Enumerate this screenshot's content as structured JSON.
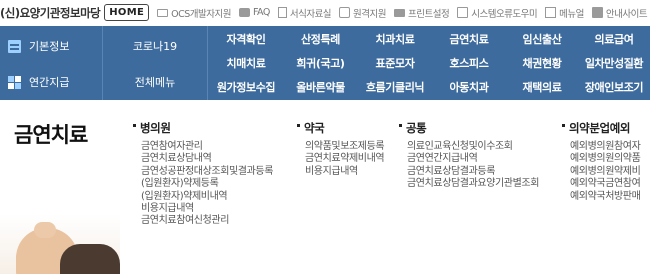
{
  "topbar": {
    "brand": "(신)요양기관정보마당",
    "home_label": "HOME",
    "links": [
      {
        "icon": "monitor-icon",
        "label": "OCS개발자지원"
      },
      {
        "icon": "chat-icon",
        "label": "FAQ"
      },
      {
        "icon": "document-icon",
        "label": "서식자료실"
      },
      {
        "icon": "remote-support-icon",
        "label": "원격지원"
      },
      {
        "icon": "printer-icon",
        "label": "프린트설정"
      },
      {
        "icon": "system-error-icon",
        "label": "시스템오류도우미"
      },
      {
        "icon": "menu-icon",
        "label": "메뉴얼"
      },
      {
        "icon": "site-guide-icon",
        "label": "안내사이트"
      }
    ]
  },
  "nav": {
    "left": [
      {
        "icon": "basic-info-icon",
        "label": "기본정보"
      },
      {
        "icon": "year-payment-icon",
        "label": "연간지급"
      }
    ],
    "middle": [
      {
        "label": "코로나19"
      },
      {
        "label": "전체메뉴"
      }
    ],
    "grid": [
      [
        "자격확인",
        "산정특례",
        "치과치료",
        "금연치료",
        "임신출산",
        "의료급여"
      ],
      [
        "치매치료",
        "희귀(국고)",
        "표준모자",
        "호스피스",
        "채권현황",
        "일차만성질환"
      ],
      [
        "원가정보수집",
        "올바른약물",
        "흐름기클리닉",
        "아동치과",
        "재택의료",
        "장애인보조기"
      ]
    ],
    "colors": {
      "background": "#3d6b9d",
      "divider": "#5a85b3",
      "text": "#ffffff",
      "icon_accent": "#9ed0ff"
    }
  },
  "main": {
    "title": "금연치료",
    "columns": [
      {
        "heading": "병의원",
        "items": [
          "금연참여자관리",
          "금연치료상담내역",
          "금연성공판정대상조회및결과등록",
          "(입원환자)약제등록",
          "(입원환자)약제비내역",
          "비용지급내역",
          "금연치료참여신청관리"
        ]
      },
      {
        "heading": "약국",
        "items": [
          "의약품및보조제등록",
          "금연치료약제비내역",
          "비용지급내역"
        ]
      },
      {
        "heading": "공통",
        "items": [
          "의료인교육신청및이수조회",
          "금연연간지급내역",
          "금연치료상담결과등록",
          "금연치료상담결과요양기관별조회"
        ]
      },
      {
        "heading": "의약분업예외",
        "items": [
          "예외병의원참여자",
          "예외병의원의약품",
          "예외병의원약제비",
          "예외약국금연참여",
          "예외약국처방판매"
        ]
      }
    ]
  }
}
